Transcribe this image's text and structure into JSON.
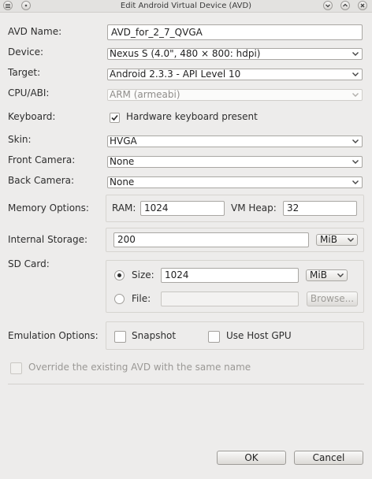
{
  "window": {
    "title": "Edit Android Virtual Device (AVD)"
  },
  "avd_name": {
    "label": "AVD Name:",
    "value": "AVD_for_2_7_QVGA"
  },
  "device": {
    "label": "Device:",
    "value": "Nexus S (4.0\", 480 × 800: hdpi)"
  },
  "target": {
    "label": "Target:",
    "value": "Android 2.3.3 - API Level 10"
  },
  "cpu_abi": {
    "label": "CPU/ABI:",
    "value": "ARM (armeabi)"
  },
  "keyboard": {
    "label": "Keyboard:",
    "checkbox_label": "Hardware keyboard present",
    "checked": true
  },
  "skin": {
    "label": "Skin:",
    "value": "HVGA"
  },
  "front_camera": {
    "label": "Front Camera:",
    "value": "None"
  },
  "back_camera": {
    "label": "Back Camera:",
    "value": "None"
  },
  "memory": {
    "label": "Memory Options:",
    "ram_label": "RAM:",
    "ram_value": "1024",
    "vm_heap_label": "VM Heap:",
    "vm_heap_value": "32"
  },
  "storage": {
    "label": "Internal Storage:",
    "value": "200",
    "unit": "MiB"
  },
  "sd_card": {
    "label": "SD Card:",
    "size_label": "Size:",
    "size_value": "1024",
    "size_unit": "MiB",
    "size_selected": true,
    "file_label": "File:",
    "file_value": "",
    "browse_label": "Browse..."
  },
  "emulation": {
    "label": "Emulation Options:",
    "snapshot_label": "Snapshot",
    "host_gpu_label": "Use Host GPU"
  },
  "override": {
    "label": "Override the existing AVD with the same name"
  },
  "buttons": {
    "ok": "OK",
    "cancel": "Cancel"
  },
  "icons": {
    "window_menu": "window-menu-icon",
    "pin": "pin-icon",
    "minimize": "minimize-icon",
    "maximize": "maximize-icon",
    "close": "close-icon",
    "dropdown": "chevron-down-icon",
    "check": "checkmark-icon"
  },
  "colors": {
    "background": "#edeceb",
    "field": "#ffffff",
    "border": "#a9a7a3",
    "disabled_text": "#9a9895"
  }
}
